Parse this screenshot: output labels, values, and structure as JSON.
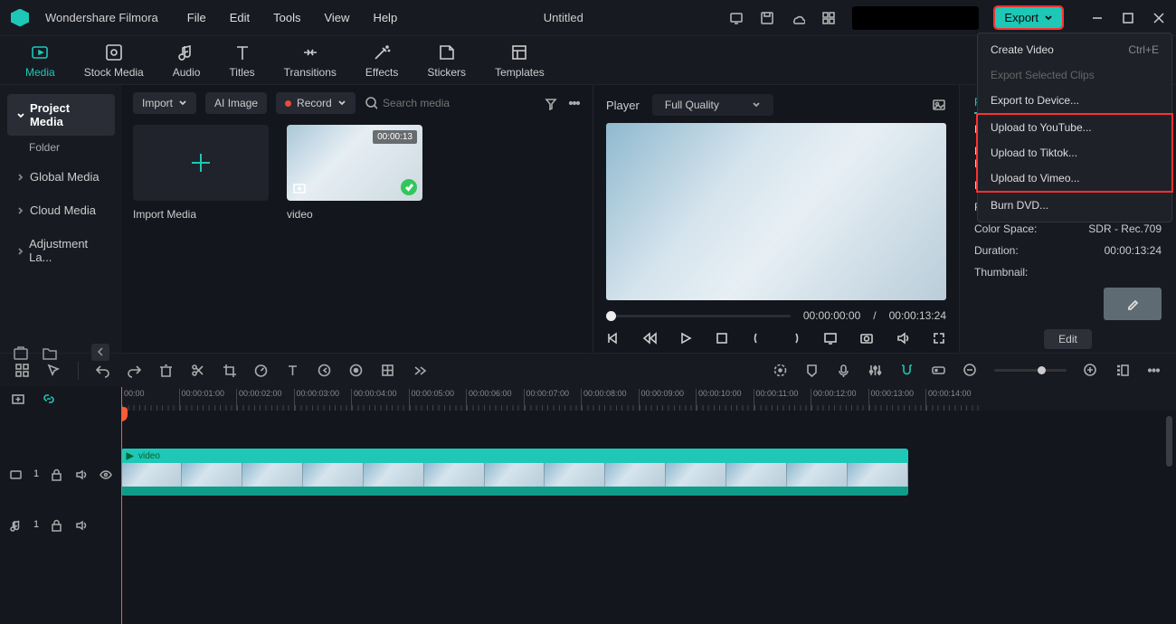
{
  "app_name": "Wondershare Filmora",
  "document_title": "Untitled",
  "menus": {
    "file": "File",
    "edit": "Edit",
    "tools": "Tools",
    "view": "View",
    "help": "Help"
  },
  "export": {
    "button": "Export",
    "items": {
      "create_video": "Create Video",
      "create_video_shortcut": "Ctrl+E",
      "export_selected": "Export Selected Clips",
      "export_device": "Export to Device...",
      "youtube": "Upload to YouTube...",
      "tiktok": "Upload to Tiktok...",
      "vimeo": "Upload to Vimeo...",
      "burn_dvd": "Burn DVD..."
    }
  },
  "tabs": {
    "media": "Media",
    "stock_media": "Stock Media",
    "audio": "Audio",
    "titles": "Titles",
    "transitions": "Transitions",
    "effects": "Effects",
    "stickers": "Stickers",
    "templates": "Templates"
  },
  "sidebar": {
    "project_media": "Project Media",
    "folder": "Folder",
    "global_media": "Global Media",
    "cloud_media": "Cloud Media",
    "adjustment": "Adjustment La..."
  },
  "media_toolbar": {
    "import": "Import",
    "ai_image": "AI Image",
    "record": "Record",
    "search_placeholder": "Search media"
  },
  "media_items": {
    "import_label": "Import Media",
    "video_label": "video",
    "video_duration": "00:00:13"
  },
  "player": {
    "label": "Player",
    "quality": "Full Quality",
    "time_current": "00:00:00:00",
    "time_sep": "/",
    "time_total": "00:00:13:24"
  },
  "properties": {
    "tab": "Proj",
    "proj": "Proj",
    "proj_loc": "Proj\nLoc",
    "res": "Res",
    "fra": "Fra",
    "color_space_label": "Color Space:",
    "color_space_value": "SDR - Rec.709",
    "duration_label": "Duration:",
    "duration_value": "00:00:13:24",
    "thumbnail_label": "Thumbnail:",
    "edit": "Edit"
  },
  "timeline": {
    "marks": [
      "00:00",
      "00:00:01:00",
      "00:00:02:00",
      "00:00:03:00",
      "00:00:04:00",
      "00:00:05:00",
      "00:00:06:00",
      "00:00:07:00",
      "00:00:08:00",
      "00:00:09:00",
      "00:00:10:00",
      "00:00:11:00",
      "00:00:12:00",
      "00:00:13:00",
      "00:00:14:00"
    ],
    "video_track_label": "1",
    "audio_track_label": "1",
    "clip_name": "video"
  }
}
